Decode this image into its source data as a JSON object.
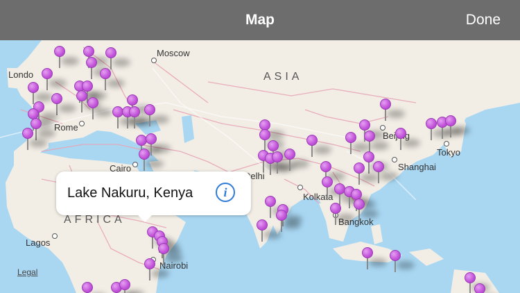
{
  "navbar": {
    "title": "Map",
    "done_label": "Done"
  },
  "callout": {
    "title": "Lake Nakuru, Kenya",
    "info_icon": "info-icon",
    "info_glyph": "i"
  },
  "map": {
    "regions": {
      "asia": "ASIA",
      "africa": "AFRICA"
    },
    "cities": {
      "moscow": "Moscow",
      "london": "Londo",
      "rome": "Rome",
      "cairo": "Cairo",
      "delhi": "Delhi",
      "kolkata": "Kolkata",
      "bangkok": "Bangkok",
      "beijing": "Beijing",
      "shanghai": "Shanghai",
      "tokyo": "Tokyo",
      "lagos": "Lagos",
      "nairobi": "Nairobi"
    },
    "legal_label": "Legal",
    "pin_color": "#c152d9",
    "water_color": "#a9d7f2",
    "land_color": "#f2eee6"
  }
}
